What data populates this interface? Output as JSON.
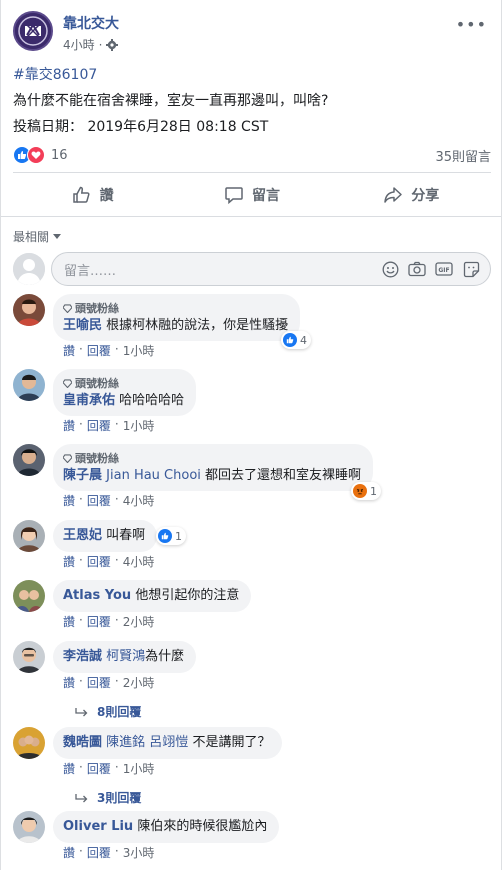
{
  "page": {
    "name": "靠北交大",
    "time": "4小時",
    "hashtag": "#靠交86107",
    "text": "為什麼不能在宿舍裸睡，室友一直再那邊叫，叫啥?",
    "posted_at": "投稿日期： 2019年6月28日 08:18 CST"
  },
  "reactions": {
    "count": "16",
    "comments_count": "35則留言"
  },
  "actions": {
    "like": "讚",
    "comment": "留言",
    "share": "分享"
  },
  "sort": {
    "label": "最相關"
  },
  "composer": {
    "placeholder": "留言……"
  },
  "comments": [
    {
      "badge": "頭號粉絲",
      "name": "王喻民",
      "text": "根據柯林融的說法，你是性騷擾",
      "react_count": "4",
      "time": "1小時"
    },
    {
      "badge": "頭號粉絲",
      "name": "皇甫承佑",
      "text": "哈哈哈哈哈",
      "time": "1小時"
    },
    {
      "badge": "頭號粉絲",
      "name": "陳子晨",
      "mention": "Jian Hau Chooi",
      "text": "都回去了還想和室友裸睡啊",
      "react_count": "1",
      "time": "4小時"
    },
    {
      "name": "王恩妃",
      "text": "叫春啊",
      "react_count": "1",
      "time": "4小時"
    },
    {
      "name": "Atlas You",
      "text": "他想引起你的注意",
      "time": "2小時"
    },
    {
      "name": "李浩誠",
      "mention": "柯賢鴻",
      "text": "為什麼",
      "time": "2小時",
      "replies": "8則回覆"
    },
    {
      "name": "魏晧圖",
      "mention": "陳進銘 呂翊愷",
      "text": "不是講開了？",
      "time": "1小時",
      "replies": "3則回覆"
    },
    {
      "name": "Oliver Liu",
      "text": "陳伯來的時候很尷尬內",
      "time": "3小時"
    }
  ],
  "comment_actions": {
    "like": "讚",
    "reply": "回覆",
    "dot": "·"
  },
  "colors": {
    "link": "#385898",
    "like": "#1877f2",
    "love": "#f33e58",
    "bubble": "#f2f3f5"
  }
}
